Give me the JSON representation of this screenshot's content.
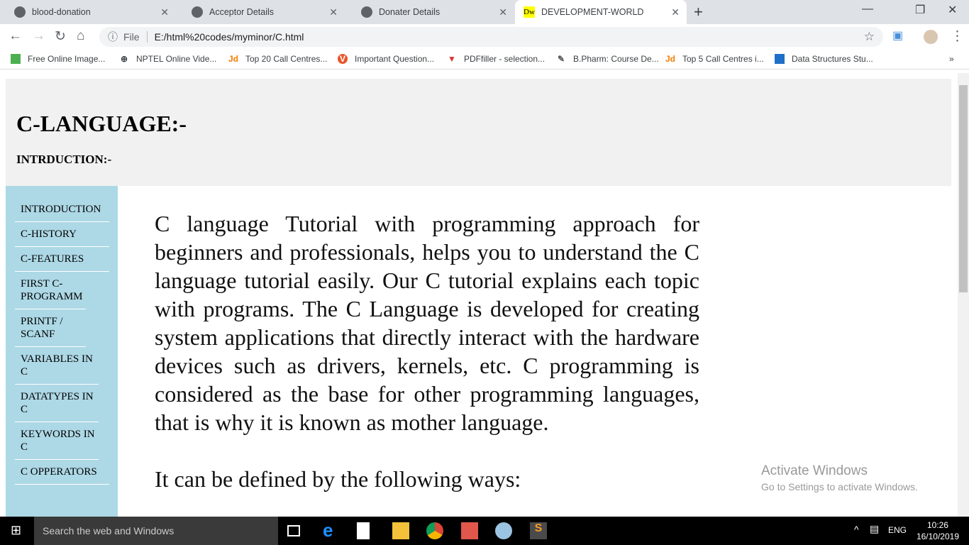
{
  "browser": {
    "tabs": [
      {
        "label": "blood-donation",
        "active": false
      },
      {
        "label": "Acceptor Details",
        "active": false
      },
      {
        "label": "Donater Details",
        "active": false
      },
      {
        "label": "DEVELOPMENT-WORLD",
        "active": true,
        "favicon": "Dw"
      }
    ],
    "address": {
      "scheme_label": "File",
      "url": "E:/html%20codes/myminor/C.html"
    },
    "bookmarks": [
      "Free Online Image...",
      "NPTEL Online Vide...",
      "Top 20 Call Centres...",
      "Important Question...",
      "PDFfiller - selection...",
      "B.Pharm: Course De...",
      "Top 5 Call Centres i...",
      "Data Structures Stu..."
    ]
  },
  "page": {
    "title": "C-LANGUAGE:-",
    "subtitle": "INTRDUCTION:-",
    "sidebar": [
      "INTRODUCTION",
      "C-HISTORY",
      "C-FEATURES",
      "FIRST C-PROGRAMM",
      "PRINTF / SCANF",
      "VARIABLES IN C",
      "DATATYPES IN C",
      "KEYWORDS IN C",
      "C OPPERATORS"
    ],
    "paragraphs": [
      "C language Tutorial with programming approach for beginners and professionals, helps you to understand the C language tutorial easily. Our C tutorial explains each topic with programs. The C Language is developed for creating system applications that directly interact with the hardware devices such as drivers, kernels, etc. C programming is considered as the base for other programming languages, that is why it is known as mother language.",
      "It can be defined by the following ways:"
    ],
    "colors": {
      "header_bg": "#f1f1f1",
      "sidebar_bg": "#add8e6"
    }
  },
  "watermark": {
    "title": "Activate Windows",
    "subtitle": "Go to Settings to activate Windows."
  },
  "taskbar": {
    "search_placeholder": "Search the web and Windows",
    "lang": "ENG",
    "time": "10:26",
    "date": "16/10/2019"
  }
}
